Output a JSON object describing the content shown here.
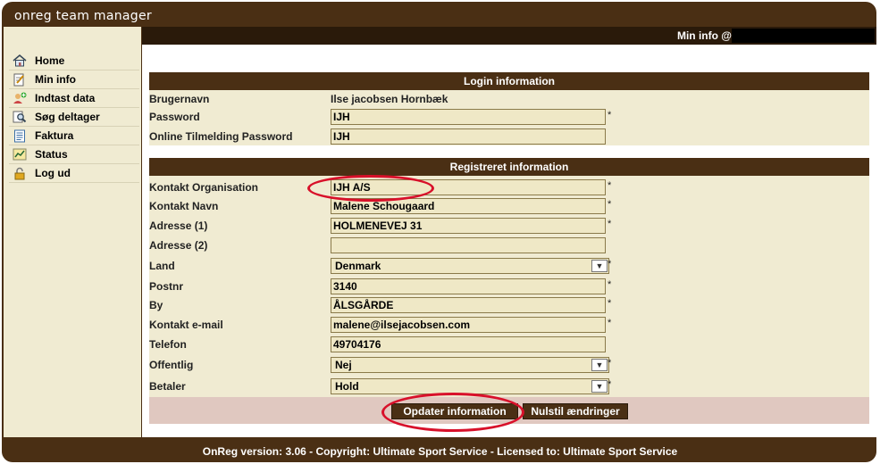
{
  "app": {
    "title": "onreg team manager"
  },
  "topbar": {
    "user_label": "Min info @"
  },
  "sidebar": {
    "items": [
      {
        "label": "Home",
        "icon": "home-icon"
      },
      {
        "label": "Min info",
        "icon": "edit-icon"
      },
      {
        "label": "Indtast data",
        "icon": "add-user-icon"
      },
      {
        "label": "Søg deltager",
        "icon": "search-icon"
      },
      {
        "label": "Faktura",
        "icon": "invoice-icon"
      },
      {
        "label": "Status",
        "icon": "status-icon"
      },
      {
        "label": "Log ud",
        "icon": "lock-icon"
      }
    ]
  },
  "login": {
    "header": "Login information",
    "username_label": "Brugernavn",
    "username_value": "Ilse jacobsen Hornbæk",
    "password_label": "Password",
    "password_value": "IJH",
    "online_password_label": "Online Tilmelding Password",
    "online_password_value": "IJH"
  },
  "registered": {
    "header": "Registreret information",
    "org_label": "Kontakt Organisation",
    "org_value": "IJH A/S",
    "name_label": "Kontakt Navn",
    "name_value": "Malene Schougaard",
    "addr1_label": "Adresse (1)",
    "addr1_value": "HOLMENEVEJ 31",
    "addr2_label": "Adresse (2)",
    "addr2_value": "",
    "country_label": "Land",
    "country_value": "Denmark",
    "zip_label": "Postnr",
    "zip_value": "3140",
    "city_label": "By",
    "city_value": "ÅLSGÅRDE",
    "email_label": "Kontakt e-mail",
    "email_value": "malene@ilsejacobsen.com",
    "phone_label": "Telefon",
    "phone_value": "49704176",
    "public_label": "Offentlig",
    "public_value": "Nej",
    "payer_label": "Betaler",
    "payer_value": "Hold",
    "required_mark": "*"
  },
  "buttons": {
    "update": "Opdater information",
    "reset": "Nulstil ændringer"
  },
  "footer": {
    "text": "OnReg version: 3.06 - Copyright: Ultimate Sport Service - Licensed to: Ultimate Sport Service"
  },
  "colors": {
    "brand": "#4a2f14",
    "panel": "#f0ebd2",
    "input": "#efe8c6",
    "annotation": "#d8102a"
  }
}
